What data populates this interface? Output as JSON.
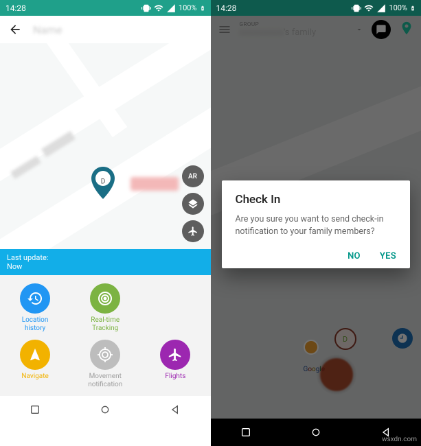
{
  "status": {
    "time": "14:28",
    "battery": "100%"
  },
  "left": {
    "appbar_title_blurred": "Name",
    "marker_letter": "D",
    "fab_ar": "AR",
    "last_update_label": "Last update:",
    "last_update_value": "Now",
    "actions": [
      {
        "label": "Location history",
        "color": "blue",
        "icon": "history"
      },
      {
        "label": "Real-time Tracking",
        "color": "green",
        "icon": "radar"
      },
      {
        "label": "Navigate",
        "color": "yellow",
        "icon": "navigate"
      },
      {
        "label": "Movement notification",
        "color": "gray",
        "icon": "target"
      },
      {
        "label": "Flights",
        "color": "purple",
        "icon": "plane"
      }
    ]
  },
  "right": {
    "group_label": "GROUP",
    "group_name_suffix": "'s family",
    "marker_letter": "D",
    "dialog": {
      "title": "Check In",
      "body": "Are you sure you want to send check-in notification to your family members?",
      "no": "NO",
      "yes": "YES"
    }
  },
  "watermark": "wsxdn.com"
}
